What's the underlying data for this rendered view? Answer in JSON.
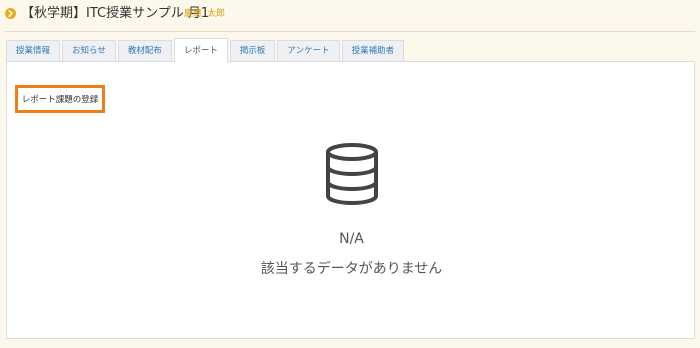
{
  "header": {
    "course_title": "【秋学期】ITC授業サンプル 月1",
    "teacher_family": "慶應",
    "teacher_given": "太郎"
  },
  "tabs": [
    {
      "label": "授業情報",
      "active": false
    },
    {
      "label": "お知らせ",
      "active": false
    },
    {
      "label": "教材配布",
      "active": false
    },
    {
      "label": "レポート",
      "active": true
    },
    {
      "label": "掲示板",
      "active": false
    },
    {
      "label": "アンケート",
      "active": false
    },
    {
      "label": "授業補助者",
      "active": false
    }
  ],
  "report": {
    "register_button_label": "レポート課題の登録",
    "empty_icon": "database-icon",
    "na_label": "N/A",
    "empty_message": "該当するデータがありません"
  },
  "colors": {
    "accent": "#eea81a",
    "highlight_border": "#f07d1a",
    "tab_link": "#337ab7",
    "background": "#fdf8ec"
  }
}
